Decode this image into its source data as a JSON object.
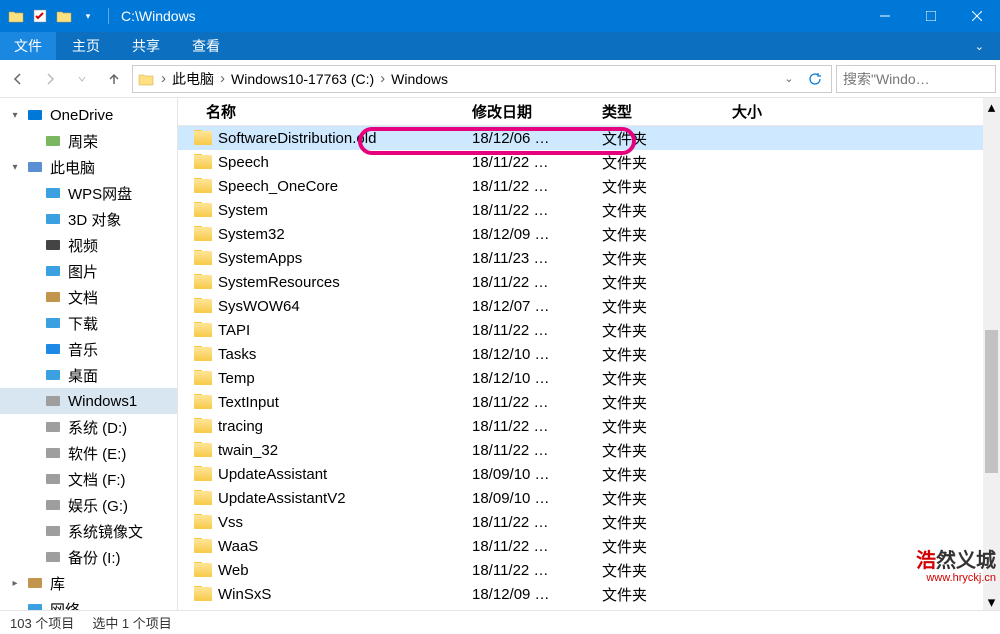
{
  "title": "C:\\Windows",
  "ribbon": {
    "file": "文件",
    "tabs": [
      "主页",
      "共享",
      "查看"
    ]
  },
  "breadcrumb": {
    "items": [
      "此电脑",
      "Windows10-17763 (C:)",
      "Windows"
    ]
  },
  "search": {
    "placeholder": "搜索\"Windo…"
  },
  "sidebar": [
    {
      "icon": "onedrive",
      "label": "OneDrive",
      "chev": "▾"
    },
    {
      "icon": "user",
      "label": "周荣",
      "indent": true
    },
    {
      "icon": "pc",
      "label": "此电脑",
      "chev": "▾"
    },
    {
      "icon": "cloud",
      "label": "WPS网盘",
      "indent": true
    },
    {
      "icon": "3d",
      "label": "3D 对象",
      "indent": true
    },
    {
      "icon": "video",
      "label": "视频",
      "indent": true
    },
    {
      "icon": "pictures",
      "label": "图片",
      "indent": true
    },
    {
      "icon": "docs",
      "label": "文档",
      "indent": true
    },
    {
      "icon": "downloads",
      "label": "下载",
      "indent": true
    },
    {
      "icon": "music",
      "label": "音乐",
      "indent": true
    },
    {
      "icon": "desktop",
      "label": "桌面",
      "indent": true
    },
    {
      "icon": "drive",
      "label": "Windows1",
      "indent": true,
      "active": true
    },
    {
      "icon": "drive",
      "label": "系统 (D:)",
      "indent": true
    },
    {
      "icon": "drive",
      "label": "软件 (E:)",
      "indent": true
    },
    {
      "icon": "drive",
      "label": "文档 (F:)",
      "indent": true
    },
    {
      "icon": "drive",
      "label": "娱乐 (G:)",
      "indent": true
    },
    {
      "icon": "drive",
      "label": "系统镜像文",
      "indent": true
    },
    {
      "icon": "drive",
      "label": "备份 (I:)",
      "indent": true
    },
    {
      "icon": "lib",
      "label": "库",
      "chev": "▸"
    },
    {
      "icon": "net",
      "label": "网络",
      "chev": ""
    }
  ],
  "columns": {
    "name": "名称",
    "date": "修改日期",
    "type": "类型",
    "size": "大小"
  },
  "rows": [
    {
      "name": "SoftwareDistribution.old",
      "date": "18/12/06 …",
      "type": "文件夹",
      "selected": true,
      "highlight": true
    },
    {
      "name": "Speech",
      "date": "18/11/22 …",
      "type": "文件夹"
    },
    {
      "name": "Speech_OneCore",
      "date": "18/11/22 …",
      "type": "文件夹"
    },
    {
      "name": "System",
      "date": "18/11/22 …",
      "type": "文件夹"
    },
    {
      "name": "System32",
      "date": "18/12/09 …",
      "type": "文件夹"
    },
    {
      "name": "SystemApps",
      "date": "18/11/23 …",
      "type": "文件夹"
    },
    {
      "name": "SystemResources",
      "date": "18/11/22 …",
      "type": "文件夹"
    },
    {
      "name": "SysWOW64",
      "date": "18/12/07 …",
      "type": "文件夹"
    },
    {
      "name": "TAPI",
      "date": "18/11/22 …",
      "type": "文件夹"
    },
    {
      "name": "Tasks",
      "date": "18/12/10 …",
      "type": "文件夹"
    },
    {
      "name": "Temp",
      "date": "18/12/10 …",
      "type": "文件夹"
    },
    {
      "name": "TextInput",
      "date": "18/11/22 …",
      "type": "文件夹"
    },
    {
      "name": "tracing",
      "date": "18/11/22 …",
      "type": "文件夹"
    },
    {
      "name": "twain_32",
      "date": "18/11/22 …",
      "type": "文件夹"
    },
    {
      "name": "UpdateAssistant",
      "date": "18/09/10 …",
      "type": "文件夹"
    },
    {
      "name": "UpdateAssistantV2",
      "date": "18/09/10 …",
      "type": "文件夹"
    },
    {
      "name": "Vss",
      "date": "18/11/22 …",
      "type": "文件夹"
    },
    {
      "name": "WaaS",
      "date": "18/11/22 …",
      "type": "文件夹"
    },
    {
      "name": "Web",
      "date": "18/11/22 …",
      "type": "文件夹"
    },
    {
      "name": "WinSxS",
      "date": "18/12/09 …",
      "type": "文件夹"
    }
  ],
  "status": {
    "total": "103 个项目",
    "selected": "选中 1 个项目"
  },
  "watermark": {
    "text": "浩然义城",
    "url": "www.hryckj.cn"
  }
}
